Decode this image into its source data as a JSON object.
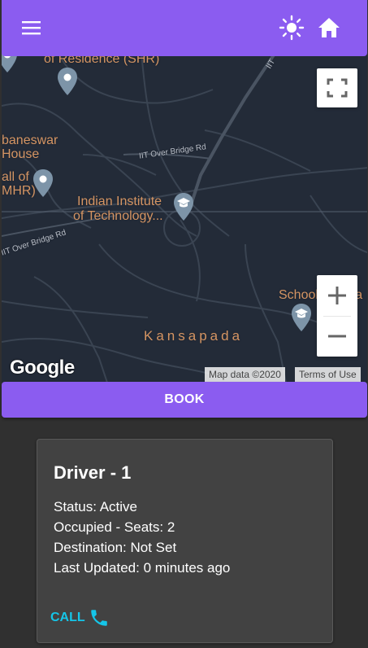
{
  "appbar": {
    "menu_icon": "menu-icon",
    "theme_icon": "sun-icon",
    "home_icon": "home-icon",
    "color": "#8b5cf0"
  },
  "map": {
    "labels": {
      "residence": "of Residence (SHR)",
      "bhubaneswar": "baneswar",
      "house": "House",
      "hall_of": "all of",
      "mhr": "MHR)",
      "iit_line1": "Indian Institute",
      "iit_line2": "of Technology...",
      "school": "School of Infra",
      "kansapada": "Kansapada",
      "road1": "IIT Over Bridge Rd",
      "road2": "IIT Over Bridge Rd",
      "road_top": "IIT"
    },
    "google": "Google",
    "attribution": "Map data ©2020",
    "terms": "Terms of Use",
    "fullscreen_icon": "fullscreen-icon",
    "zoom_in_icon": "plus-icon",
    "zoom_out_icon": "minus-icon"
  },
  "book_label": "BOOK",
  "driver": {
    "title": "Driver - 1",
    "status": "Status: Active",
    "seats": "Occupied - Seats: 2",
    "destination": "Destination: Not Set",
    "updated": "Last Updated: 0 minutes ago",
    "call_label": "CALL",
    "call_icon": "phone-icon",
    "call_color": "#15c5e8"
  }
}
